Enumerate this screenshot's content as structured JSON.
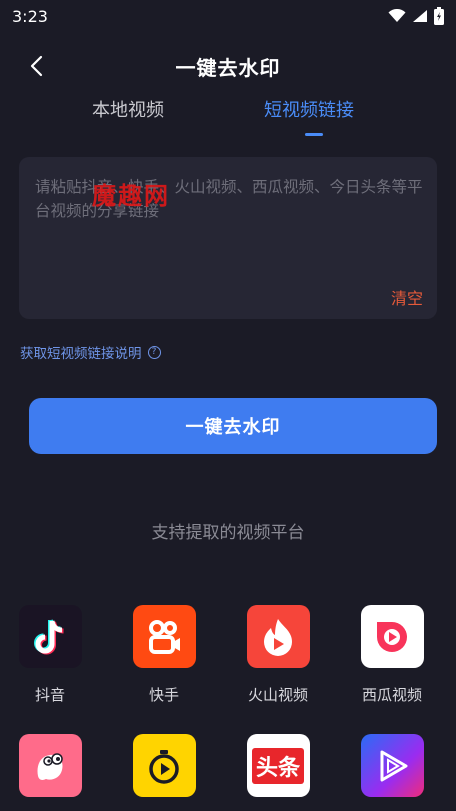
{
  "status": {
    "time": "3:23"
  },
  "header": {
    "title": "一键去水印"
  },
  "tabs": [
    {
      "label": "本地视频"
    },
    {
      "label": "短视频链接"
    }
  ],
  "input": {
    "placeholder": "请粘贴抖音、快手、火山视频、西瓜视频、今日头条等平台视频的分享链接",
    "clear_label": "清空"
  },
  "watermark_text": "魔趣网",
  "help_link": {
    "label": "获取短视频链接说明",
    "icon": "question-circle-icon"
  },
  "main_button": {
    "label": "一键去水印"
  },
  "platforms": {
    "title": "支持提取的视频平台",
    "items": [
      {
        "label": "抖音",
        "icon": "douyin-icon",
        "color": "#1a1424"
      },
      {
        "label": "快手",
        "icon": "kuaishou-icon",
        "color": "#ff4a12"
      },
      {
        "label": "火山视频",
        "icon": "huoshan-icon",
        "color": "#f6453a"
      },
      {
        "label": "西瓜视频",
        "icon": "xigua-icon",
        "color": "#ffffff"
      },
      {
        "label": "",
        "icon": "pipixia-icon",
        "color": "#ff6b8a"
      },
      {
        "label": "",
        "icon": "weishi-icon",
        "color": "#ffd400"
      },
      {
        "label": "",
        "icon": "toutiao-icon",
        "text": "头条",
        "color": "#ffffff"
      },
      {
        "label": "",
        "icon": "haokan-icon",
        "color": "#7a3cf0"
      }
    ]
  }
}
